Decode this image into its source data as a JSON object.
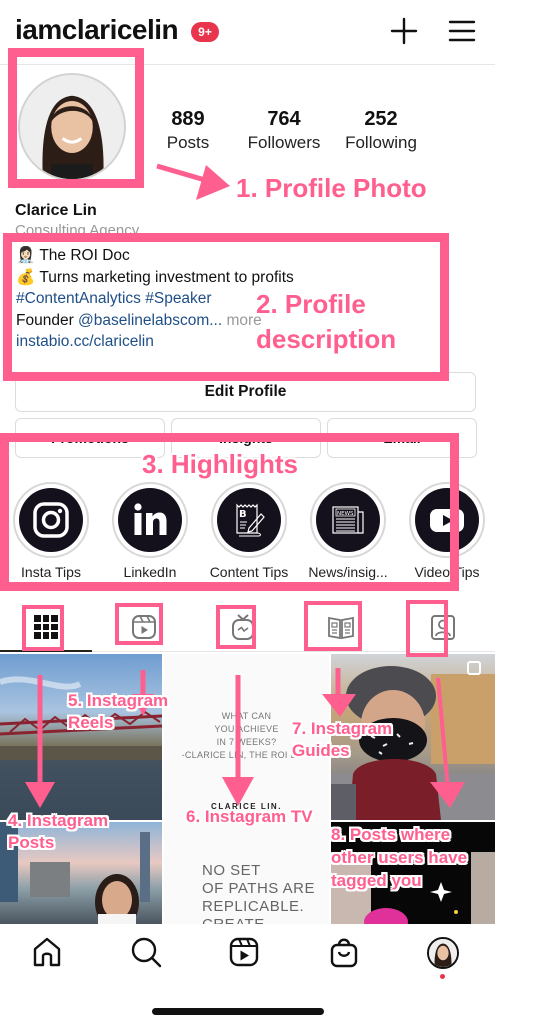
{
  "header": {
    "username": "iamclaricelin",
    "notification_badge": "9+",
    "badge_color": "#e8344c",
    "icons": [
      "plus-icon",
      "menu-icon"
    ]
  },
  "profile": {
    "stats": [
      {
        "value": "889",
        "label": "Posts"
      },
      {
        "value": "764",
        "label": "Followers"
      },
      {
        "value": "252",
        "label": "Following"
      }
    ],
    "name": "Clarice Lin",
    "category": "Consulting Agency",
    "bio": {
      "line1_emoji": "👩🏻‍⚕️",
      "line1": "The ROI Doc",
      "line2_emoji": "💰",
      "line2": "Turns marketing investment to profits",
      "hashtags": "#ContentAnalytics #Speaker",
      "founder_prefix": "Founder ",
      "founder_handle": "@baselinelabscom...",
      "more": " more",
      "website": "instabio.cc/claricelin"
    }
  },
  "buttons": {
    "edit_profile": "Edit Profile",
    "promotions": "Promotions",
    "insights": "Insights",
    "email": "Email"
  },
  "highlights": [
    {
      "label": "Insta Tips",
      "icon": "instagram-icon"
    },
    {
      "label": "LinkedIn",
      "icon": "linkedin-icon"
    },
    {
      "label": "Content Tips",
      "icon": "blog-writing-icon"
    },
    {
      "label": "News/insig...",
      "icon": "newspaper-icon"
    },
    {
      "label": "Video Tips",
      "icon": "youtube-play-icon"
    }
  ],
  "tabs": [
    {
      "name": "posts-grid",
      "icon": "grid-icon",
      "active": true
    },
    {
      "name": "reels",
      "icon": "reels-icon",
      "active": false
    },
    {
      "name": "igtv",
      "icon": "igtv-icon",
      "active": false
    },
    {
      "name": "guides",
      "icon": "guides-icon",
      "active": false
    },
    {
      "name": "tagged",
      "icon": "tagged-person-icon",
      "active": false
    }
  ],
  "grid_posts": {
    "igtv_quote": [
      "WHAT CAN",
      "YOU ACHIEVE",
      "IN 7 WEEKS?",
      "-CLARICE LIN, THE ROI DOC"
    ],
    "igtv_brand": "CLARICE LIN.",
    "igtv_big": [
      "NO SET",
      "OF PATHS ARE",
      "REPLICABLE.",
      "CREATE"
    ]
  },
  "bottom_nav": [
    {
      "name": "home",
      "icon": "home-icon"
    },
    {
      "name": "search",
      "icon": "search-icon"
    },
    {
      "name": "reels",
      "icon": "reels-icon"
    },
    {
      "name": "shop",
      "icon": "shopping-bag-icon"
    },
    {
      "name": "profile",
      "icon": "profile-avatar"
    }
  ],
  "annotations": {
    "color": "#ff5f8f",
    "a1": "1. Profile Photo",
    "a2_line1": "2. Profile",
    "a2_line2": "description",
    "a3": "3. Highlights",
    "a4_line1": "4. Instagram",
    "a4_line2": "Posts",
    "a5_line1": "5. Instagram",
    "a5_line2": "Reels",
    "a6": "6. Instagram TV",
    "a7_line1": "7. Instagram",
    "a7_line2": "Guides",
    "a8_line1": "8. Posts where",
    "a8_line2": "other users have",
    "a8_line3": "tagged you"
  }
}
